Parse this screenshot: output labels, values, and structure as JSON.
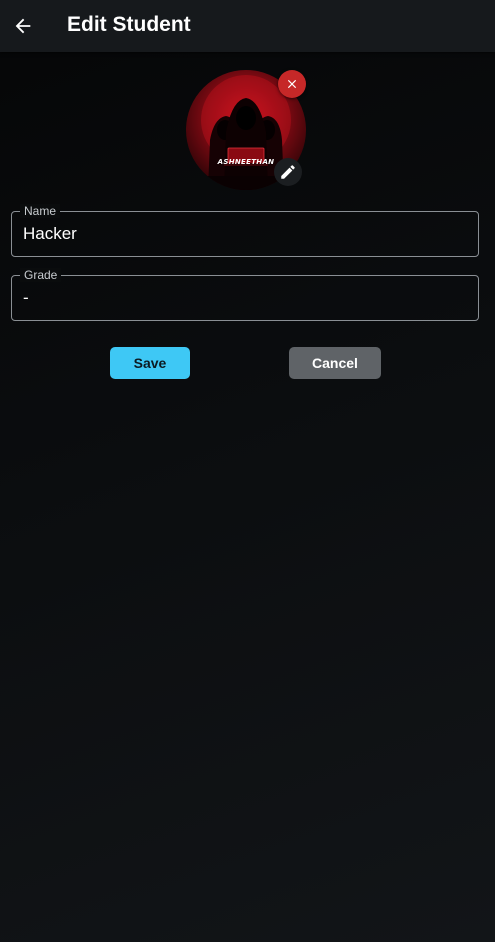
{
  "header": {
    "title": "Edit Student",
    "back_icon": "arrow-left-icon"
  },
  "avatar": {
    "watermark_text": "ASHNEETHAN",
    "remove_icon": "close-icon",
    "edit_icon": "pencil-icon",
    "accent_color": "#c62828"
  },
  "form": {
    "name": {
      "label": "Name",
      "value": "Hacker"
    },
    "grade": {
      "label": "Grade",
      "value": "-"
    }
  },
  "actions": {
    "save_label": "Save",
    "cancel_label": "Cancel",
    "save_color": "#3ec8f5",
    "cancel_color": "#5f6367"
  }
}
